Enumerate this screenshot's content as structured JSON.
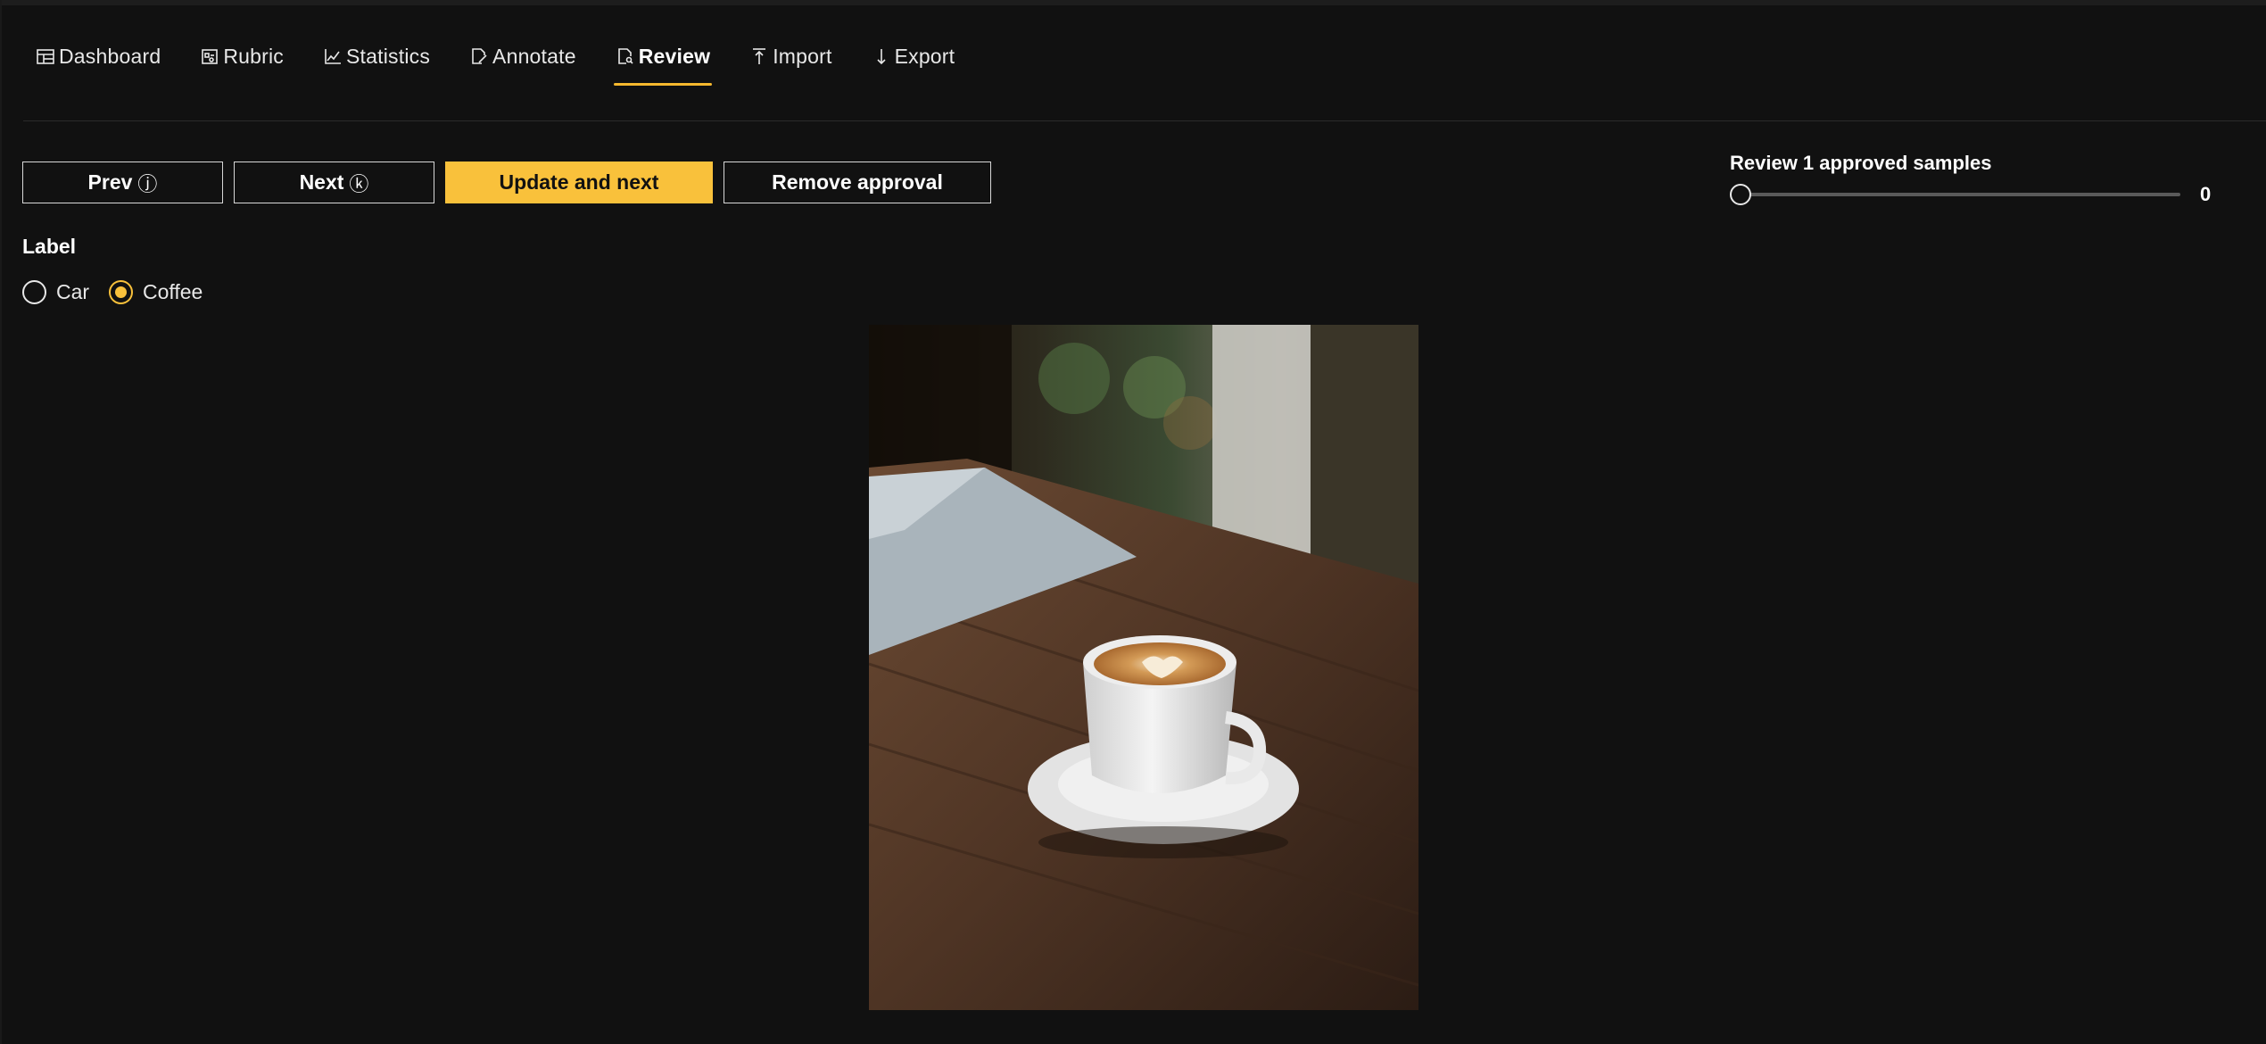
{
  "nav": {
    "tabs": [
      {
        "label": "Dashboard",
        "icon": "dashboard-icon"
      },
      {
        "label": "Rubric",
        "icon": "rubric-icon"
      },
      {
        "label": "Statistics",
        "icon": "statistics-icon"
      },
      {
        "label": "Annotate",
        "icon": "annotate-icon"
      },
      {
        "label": "Review",
        "icon": "review-icon",
        "active": true
      },
      {
        "label": "Import",
        "icon": "import-icon"
      },
      {
        "label": "Export",
        "icon": "export-icon"
      }
    ]
  },
  "toolbar": {
    "prev_label": "Prev",
    "prev_key": "ⓙ",
    "next_label": "Next",
    "next_key": "ⓚ",
    "update_label": "Update and next",
    "remove_label": "Remove approval"
  },
  "review": {
    "title": "Review 1 approved samples",
    "slider_value": "0"
  },
  "label": {
    "heading": "Label",
    "options": [
      {
        "label": "Car",
        "checked": false
      },
      {
        "label": "Coffee",
        "checked": true
      }
    ]
  },
  "colors": {
    "accent": "#f9c13b",
    "background": "#111111",
    "text": "#ececec"
  }
}
